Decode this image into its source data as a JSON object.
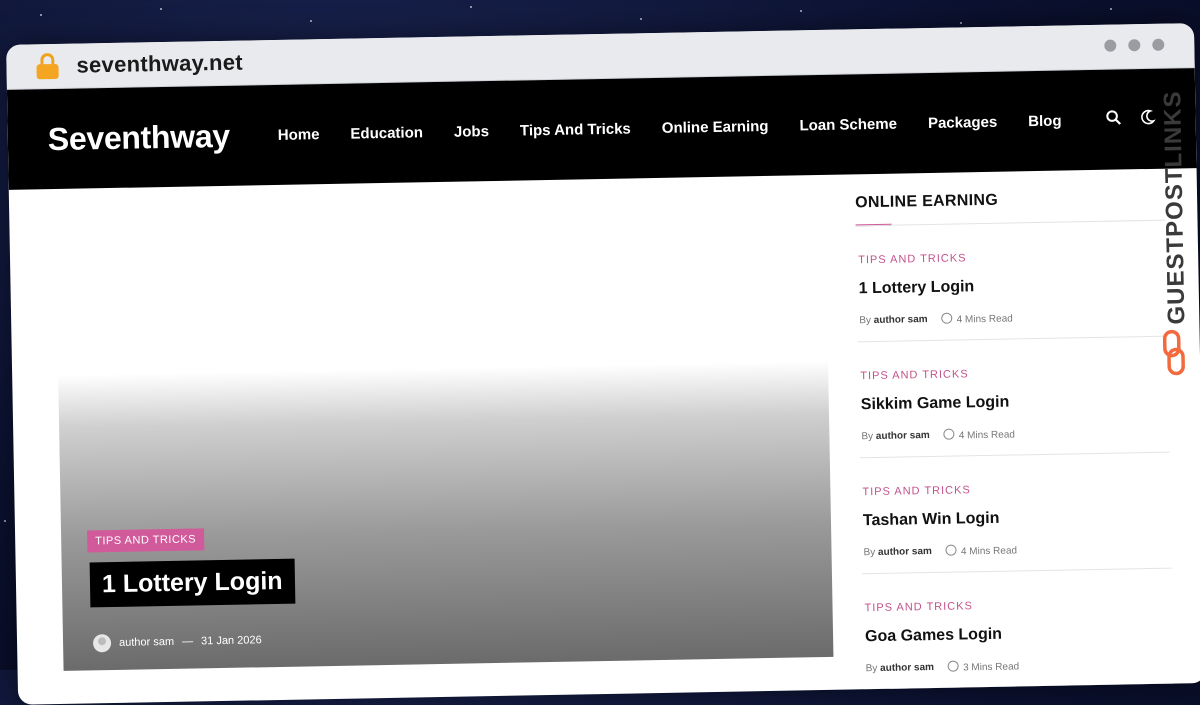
{
  "browser": {
    "url": "seventhway.net"
  },
  "site": {
    "brand": "Seventhway",
    "menu": [
      "Home",
      "Education",
      "Jobs",
      "Tips And Tricks",
      "Online Earning",
      "Loan Scheme",
      "Packages",
      "Blog"
    ]
  },
  "hero": {
    "category": "TIPS AND TRICKS",
    "title": "1 Lottery Login",
    "author": "author sam",
    "separator": "—",
    "date": "31 Jan 2026"
  },
  "sidebar": {
    "heading": "ONLINE EARNING",
    "by_label": "By",
    "posts": [
      {
        "category": "TIPS AND TRICKS",
        "title": "1 Lottery Login",
        "author": "author sam",
        "read": "4 Mins Read"
      },
      {
        "category": "TIPS AND TRICKS",
        "title": "Sikkim Game Login",
        "author": "author sam",
        "read": "4 Mins Read"
      },
      {
        "category": "TIPS AND TRICKS",
        "title": "Tashan Win Login",
        "author": "author sam",
        "read": "4 Mins Read"
      },
      {
        "category": "TIPS AND TRICKS",
        "title": "Goa Games Login",
        "author": "author sam",
        "read": "3 Mins Read"
      }
    ]
  },
  "watermark": {
    "text": "GUESTPOSTLINKS"
  },
  "colors": {
    "accent": "#d15b9a",
    "nav_bg": "#000000",
    "lock": "#f4a623",
    "watermark_icon": "#f26a3d"
  },
  "icons": [
    "lock-icon",
    "search-icon",
    "moon-icon",
    "clock-icon",
    "link-icon"
  ]
}
